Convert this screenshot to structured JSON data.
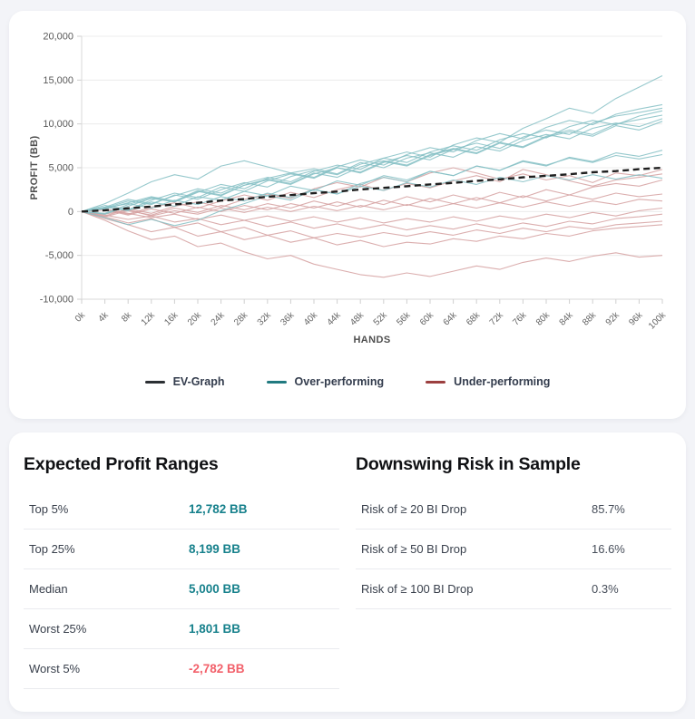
{
  "chart_data": {
    "type": "line",
    "xlabel": "HANDS",
    "ylabel": "PROFIT (BB)",
    "x_step": 4000,
    "x_max": 100000,
    "ylim": [
      -10000,
      20000
    ],
    "grid": true,
    "legend_position": "bottom",
    "x_ticks": [
      "0k",
      "4k",
      "8k",
      "12k",
      "16k",
      "20k",
      "24k",
      "28k",
      "32k",
      "36k",
      "40k",
      "44k",
      "48k",
      "52k",
      "56k",
      "60k",
      "64k",
      "68k",
      "72k",
      "76k",
      "80k",
      "84k",
      "88k",
      "92k",
      "96k",
      "100k"
    ],
    "y_ticks": [
      {
        "value": 20000,
        "label": "20,000"
      },
      {
        "value": 15000,
        "label": "15,000"
      },
      {
        "value": 10000,
        "label": "10,000"
      },
      {
        "value": 5000,
        "label": "5,000"
      },
      {
        "value": 0,
        "label": "0"
      },
      {
        "value": -5000,
        "label": "-5,000"
      },
      {
        "value": -10000,
        "label": "-10,000"
      }
    ],
    "colors": {
      "ev_line": "#1f1f1f",
      "over_line": "#85c0c4",
      "under_line": "#d5a0a0",
      "grid": "#ececec",
      "axis": "#d8d8d8"
    },
    "ev_values": [
      0,
      150,
      380,
      560,
      820,
      1000,
      1260,
      1430,
      1690,
      1880,
      2100,
      2280,
      2520,
      2700,
      2890,
      3100,
      3270,
      3500,
      3680,
      3900,
      4080,
      4260,
      4480,
      4620,
      4830,
      5000
    ],
    "overperforming": [
      [
        0,
        500,
        1400,
        900,
        1800,
        2600,
        2100,
        3200,
        3900,
        3400,
        4600,
        5300,
        4800,
        6100,
        6800,
        6200,
        7600,
        8400,
        7900,
        9500,
        10600,
        11800,
        11200,
        12900,
        14200,
        15500
      ],
      [
        0,
        -300,
        600,
        1500,
        1100,
        2200,
        3100,
        2600,
        3800,
        4400,
        3900,
        5100,
        5900,
        5300,
        6500,
        7300,
        6800,
        8100,
        8900,
        8300,
        9600,
        10400,
        9900,
        11100,
        11700,
        12200
      ],
      [
        0,
        700,
        200,
        1300,
        2100,
        1600,
        2800,
        2300,
        3500,
        4300,
        3800,
        5000,
        4400,
        5600,
        6400,
        5900,
        7100,
        7800,
        7200,
        8500,
        9300,
        8800,
        10100,
        10900,
        11300,
        11800
      ],
      [
        0,
        400,
        1200,
        800,
        1900,
        1400,
        2500,
        3300,
        2800,
        4000,
        4700,
        4200,
        5400,
        6100,
        5600,
        6800,
        7500,
        7000,
        8200,
        8900,
        8400,
        9700,
        10400,
        9900,
        10900,
        11500
      ],
      [
        0,
        -200,
        800,
        1600,
        1100,
        2300,
        1800,
        3000,
        3700,
        3200,
        4400,
        3900,
        5100,
        5800,
        5300,
        6500,
        7200,
        6700,
        7900,
        7400,
        8600,
        9300,
        8800,
        10000,
        10500,
        11000
      ],
      [
        0,
        900,
        2100,
        3400,
        4200,
        3700,
        5200,
        5800,
        5100,
        4400,
        4900,
        4300,
        5600,
        5000,
        6100,
        6700,
        6200,
        7400,
        6900,
        8100,
        8800,
        8300,
        9500,
        10100,
        9700,
        10600
      ],
      [
        0,
        300,
        1000,
        1700,
        1200,
        2400,
        1900,
        3000,
        3600,
        3100,
        4300,
        5000,
        4500,
        5700,
        5200,
        6400,
        7100,
        6600,
        7800,
        7300,
        8500,
        9100,
        8600,
        9800,
        9300,
        10300
      ],
      [
        0,
        500,
        100,
        1100,
        600,
        1700,
        1300,
        2300,
        1800,
        2900,
        2400,
        3500,
        3000,
        4100,
        3600,
        4600,
        4100,
        5200,
        4700,
        5700,
        5200,
        6200,
        5700,
        6700,
        6300,
        7000
      ],
      [
        0,
        -700,
        -1500,
        -900,
        -1600,
        -1000,
        100,
        900,
        1800,
        1300,
        2500,
        2000,
        3200,
        3900,
        3400,
        4600,
        4100,
        5200,
        4700,
        5800,
        5300,
        6100,
        5600,
        6400,
        6000,
        6500
      ],
      [
        0,
        400,
        900,
        400,
        1300,
        800,
        1700,
        1200,
        2100,
        1600,
        2500,
        2000,
        2900,
        2400,
        3300,
        2800,
        3600,
        3100,
        3900,
        3400,
        4100,
        3600,
        4200,
        3700,
        4200,
        3800
      ]
    ],
    "underperforming": [
      [
        0,
        -500,
        300,
        -200,
        600,
        1100,
        500,
        1400,
        2000,
        1500,
        2600,
        3300,
        2800,
        3900,
        3400,
        4400,
        5000,
        4400,
        3700,
        4300,
        3600,
        4100,
        3300,
        4400,
        4100,
        4800
      ],
      [
        0,
        300,
        -300,
        500,
        1000,
        400,
        1200,
        1900,
        1300,
        2200,
        1600,
        2500,
        3100,
        2400,
        3200,
        2700,
        3500,
        4100,
        3400,
        4800,
        4200,
        3500,
        2900,
        3600,
        3900,
        4300
      ],
      [
        0,
        -600,
        100,
        -400,
        400,
        -100,
        700,
        200,
        900,
        400,
        1200,
        600,
        1400,
        800,
        1700,
        1100,
        1900,
        1300,
        2200,
        1600,
        2500,
        1900,
        2800,
        3200,
        2900,
        3600
      ],
      [
        0,
        200,
        -400,
        300,
        -200,
        500,
        0,
        700,
        200,
        900,
        400,
        1100,
        500,
        1300,
        700,
        1500,
        900,
        1600,
        1000,
        1800,
        1200,
        1900,
        1400,
        2100,
        1700,
        2000
      ],
      [
        0,
        -300,
        200,
        -500,
        100,
        -300,
        400,
        -100,
        500,
        0,
        600,
        100,
        700,
        200,
        800,
        300,
        900,
        400,
        1000,
        500,
        1100,
        600,
        1200,
        800,
        1400,
        1200
      ],
      [
        0,
        300,
        -200,
        -700,
        -300,
        -900,
        -400,
        -1000,
        -500,
        -1100,
        -600,
        -1200,
        -700,
        -1300,
        -800,
        -1200,
        -600,
        -1100,
        -500,
        -900,
        -300,
        -700,
        -100,
        -500,
        100,
        400
      ],
      [
        0,
        -400,
        -900,
        -500,
        -1200,
        -800,
        -1500,
        -1000,
        -1700,
        -1200,
        -1900,
        -1400,
        -2000,
        -1500,
        -2100,
        -1600,
        -2000,
        -1400,
        -1900,
        -1300,
        -1700,
        -1100,
        -1400,
        -800,
        -600,
        -300
      ],
      [
        0,
        -600,
        -1300,
        -800,
        -1800,
        -1300,
        -2300,
        -1800,
        -2700,
        -2200,
        -3000,
        -2500,
        -2900,
        -2400,
        -2800,
        -2300,
        -2700,
        -2100,
        -2500,
        -1900,
        -2300,
        -1700,
        -2000,
        -1500,
        -1300,
        -1100
      ],
      [
        0,
        -800,
        -1500,
        -2300,
        -1800,
        -2800,
        -2300,
        -3200,
        -2700,
        -3500,
        -3000,
        -3800,
        -3300,
        -4000,
        -3500,
        -3700,
        -3100,
        -3400,
        -2800,
        -3100,
        -2500,
        -2800,
        -2200,
        -1900,
        -1700,
        -1500
      ],
      [
        0,
        -1000,
        -2200,
        -3200,
        -2800,
        -4000,
        -3600,
        -4600,
        -5400,
        -5000,
        -6000,
        -6600,
        -7200,
        -7500,
        -7000,
        -7400,
        -6800,
        -6200,
        -6600,
        -5800,
        -5300,
        -5700,
        -5100,
        -4700,
        -5200,
        -5000
      ]
    ],
    "legend": [
      {
        "label": "EV-Graph",
        "color": "#2b2f33"
      },
      {
        "label": "Over-performing",
        "color": "#217a80"
      },
      {
        "label": "Under-performing",
        "color": "#9c3f3f"
      }
    ]
  },
  "tables": {
    "profit_ranges": {
      "title": "Expected Profit Ranges",
      "rows": [
        {
          "label": "Top 5%",
          "value": "12,782 BB",
          "value_color": "teal"
        },
        {
          "label": "Top 25%",
          "value": "8,199 BB",
          "value_color": "teal"
        },
        {
          "label": "Median",
          "value": "5,000 BB",
          "value_color": "teal"
        },
        {
          "label": "Worst 25%",
          "value": "1,801 BB",
          "value_color": "teal"
        },
        {
          "label": "Worst 5%",
          "value": "-2,782 BB",
          "value_color": "red"
        }
      ]
    },
    "downswing_risk": {
      "title": "Downswing Risk in Sample",
      "rows": [
        {
          "label": "Risk of ≥ 20 BI Drop",
          "value": "85.7%",
          "value_color": "plain"
        },
        {
          "label": "Risk of ≥ 50 BI Drop",
          "value": "16.6%",
          "value_color": "plain"
        },
        {
          "label": "Risk of ≥ 100 BI Drop",
          "value": "0.3%",
          "value_color": "plain"
        }
      ]
    }
  }
}
